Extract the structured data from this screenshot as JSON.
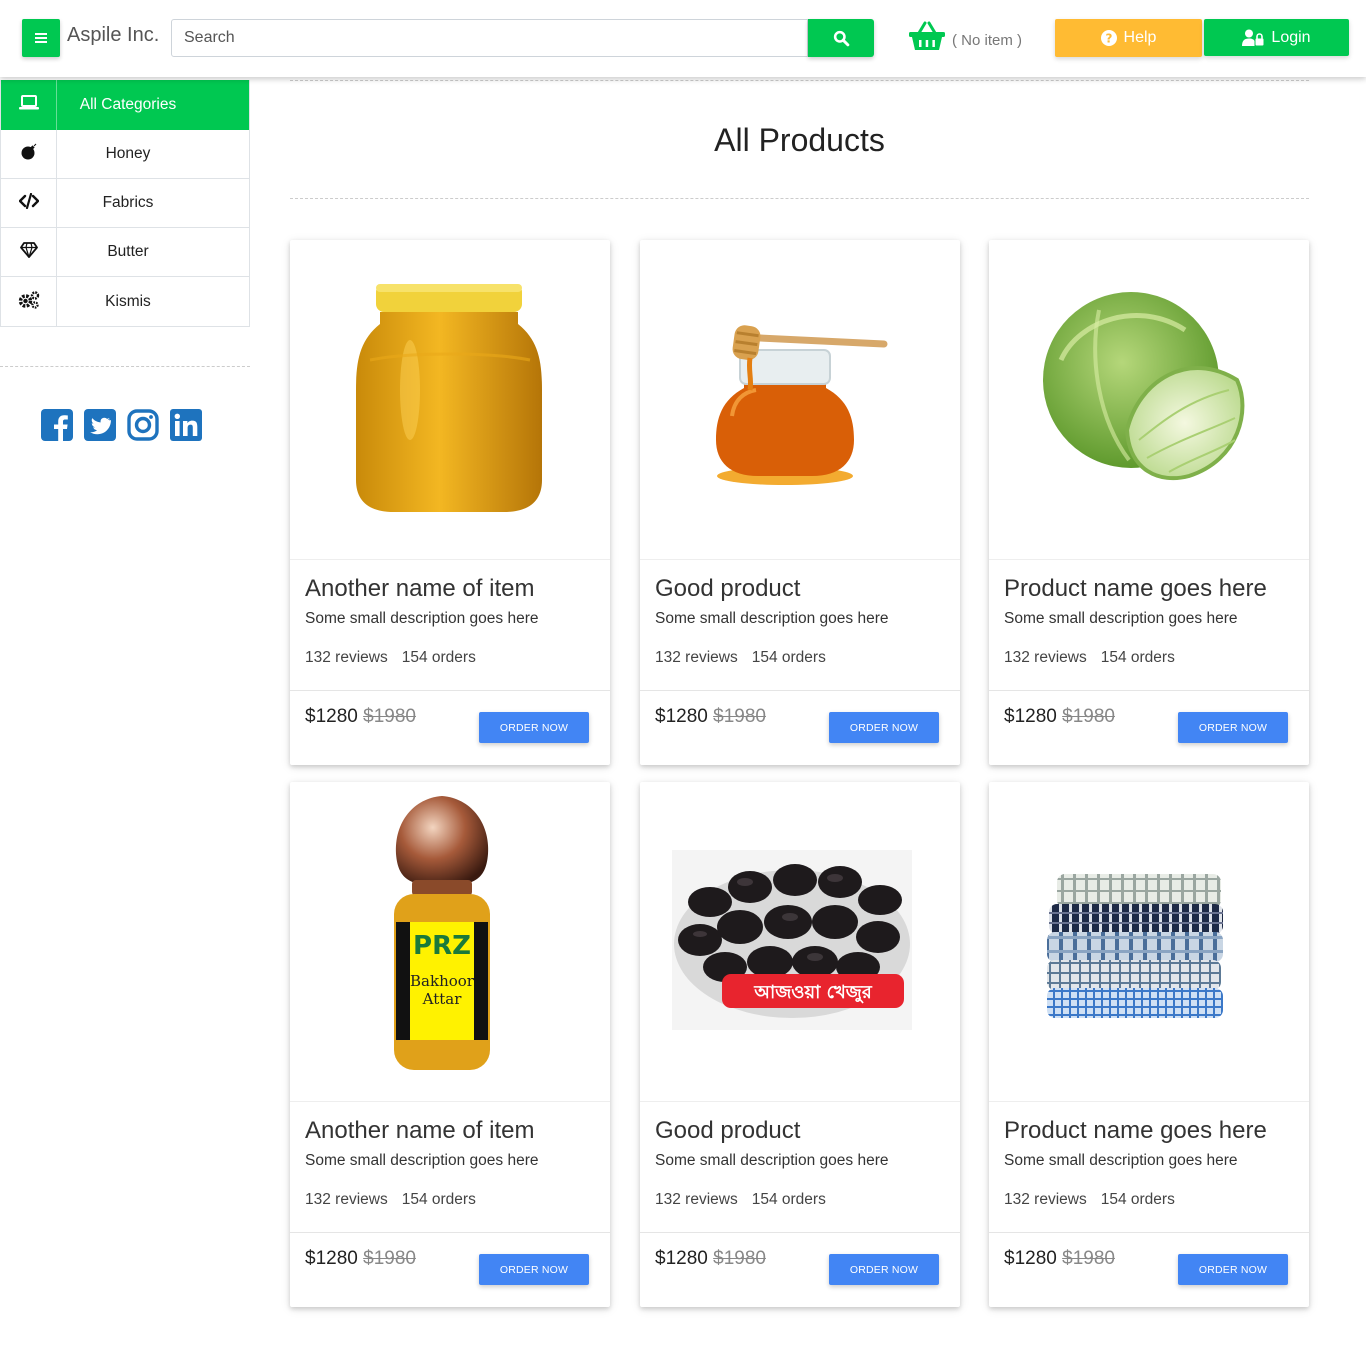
{
  "header": {
    "brand": "Aspile Inc.",
    "search_placeholder": "Search",
    "cart_text": "( No item )",
    "help_label": "Help",
    "login_label": "Login"
  },
  "sidebar": {
    "categories": [
      {
        "label": "All Categories",
        "icon": "laptop-icon",
        "active": true
      },
      {
        "label": "Honey",
        "icon": "bomb-icon"
      },
      {
        "label": "Fabrics",
        "icon": "code-icon"
      },
      {
        "label": "Butter",
        "icon": "gem-icon"
      },
      {
        "label": "Kismis",
        "icon": "gears-icon"
      }
    ],
    "socials": [
      "facebook-icon",
      "twitter-icon",
      "instagram-icon",
      "linkedin-icon"
    ]
  },
  "main": {
    "title": "All Products",
    "products": [
      {
        "name": "Another name of item",
        "desc": "Some small description goes here",
        "reviews": "132 reviews",
        "orders": "154 orders",
        "price": "$1280",
        "old_price": "$1980",
        "button": "ORDER NOW",
        "image": "ghee-jar"
      },
      {
        "name": "Good product",
        "desc": "Some small description goes here",
        "reviews": "132 reviews",
        "orders": "154 orders",
        "price": "$1280",
        "old_price": "$1980",
        "button": "ORDER NOW",
        "image": "honey-jar"
      },
      {
        "name": "Product name goes here",
        "desc": "Some small description goes here",
        "reviews": "132 reviews",
        "orders": "154 orders",
        "price": "$1280",
        "old_price": "$1980",
        "button": "ORDER NOW",
        "image": "cabbage"
      },
      {
        "name": "Another name of item",
        "desc": "Some small description goes here",
        "reviews": "132 reviews",
        "orders": "154 orders",
        "price": "$1280",
        "old_price": "$1980",
        "button": "ORDER NOW",
        "image": "attar-bottle"
      },
      {
        "name": "Good product",
        "desc": "Some small description goes here",
        "reviews": "132 reviews",
        "orders": "154 orders",
        "price": "$1280",
        "old_price": "$1980",
        "button": "ORDER NOW",
        "image": "ajwa-dates",
        "image_label": "আজওয়া খেজুর"
      },
      {
        "name": "Product name goes here",
        "desc": "Some small description goes here",
        "reviews": "132 reviews",
        "orders": "154 orders",
        "price": "$1280",
        "old_price": "$1980",
        "button": "ORDER NOW",
        "image": "folded-fabrics"
      }
    ]
  },
  "colors": {
    "green": "#00c851",
    "yellow": "#ffbb33",
    "blue": "#4285f4",
    "social": "#1e73be"
  }
}
